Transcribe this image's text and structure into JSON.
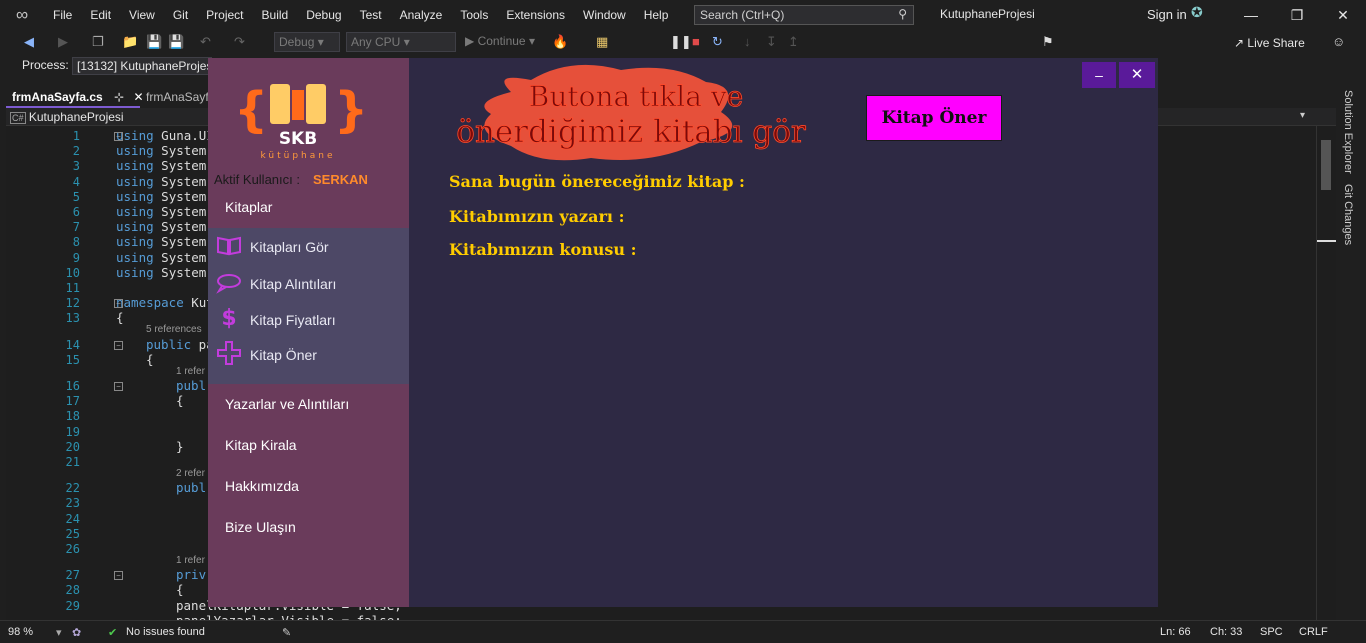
{
  "vs": {
    "menu": [
      "File",
      "Edit",
      "View",
      "Git",
      "Project",
      "Build",
      "Debug",
      "Test",
      "Analyze",
      "Tools",
      "Extensions",
      "Window",
      "Help"
    ],
    "search_placeholder": "Search (Ctrl+Q)",
    "project_title": "KutuphaneProjesi",
    "sign_in": "Sign in",
    "config_dropdown": "Debug",
    "platform_dropdown": "Any CPU",
    "continue_label": "Continue",
    "live_share": "Live Share",
    "process_label": "Process:",
    "process_value": "[13132] KutuphaneProjesi",
    "tabs": [
      "frmAnaSayfa.cs",
      "frmAnaSayfa"
    ],
    "nav_project": "KutuphaneProjesi",
    "right_tabs": [
      "Solution Explorer",
      "Git Changes"
    ],
    "status": {
      "zoom": "98 %",
      "issues": "No issues found",
      "ln": "Ln: 66",
      "ch": "Ch: 33",
      "spc": "SPC",
      "crlf": "CRLF"
    },
    "code_lines": [
      {
        "n": "1",
        "kw": "using",
        "rest": " Guna.UI"
      },
      {
        "n": "2",
        "kw": "using",
        "rest": " System"
      },
      {
        "n": "3",
        "kw": "using",
        "rest": " System"
      },
      {
        "n": "4",
        "kw": "using",
        "rest": " System"
      },
      {
        "n": "5",
        "kw": "using",
        "rest": " System"
      },
      {
        "n": "6",
        "kw": "using",
        "rest": " System"
      },
      {
        "n": "7",
        "kw": "using",
        "rest": " System"
      },
      {
        "n": "8",
        "kw": "using",
        "rest": " System"
      },
      {
        "n": "9",
        "kw": "using",
        "rest": " System"
      },
      {
        "n": "10",
        "kw": "using",
        "rest": " System"
      },
      {
        "n": "11",
        "kw": "",
        "rest": ""
      },
      {
        "n": "12",
        "kw": "namespace",
        "rest": " Kut"
      },
      {
        "n": "13",
        "kw": "",
        "rest": "{"
      },
      {
        "n": "14",
        "kw": "public",
        "rest": " pa"
      },
      {
        "n": "15",
        "kw": "",
        "rest": "{"
      },
      {
        "n": "16",
        "kw": "publ",
        "rest": ""
      },
      {
        "n": "17",
        "kw": "",
        "rest": "{"
      },
      {
        "n": "18",
        "kw": "",
        "rest": ""
      },
      {
        "n": "19",
        "kw": "",
        "rest": ""
      },
      {
        "n": "20",
        "kw": "",
        "rest": "}"
      },
      {
        "n": "21",
        "kw": "",
        "rest": ""
      },
      {
        "n": "22",
        "kw": "publ",
        "rest": ""
      },
      {
        "n": "23",
        "kw": "",
        "rest": ""
      },
      {
        "n": "24",
        "kw": "",
        "rest": ""
      },
      {
        "n": "25",
        "kw": "",
        "rest": ""
      },
      {
        "n": "26",
        "kw": "",
        "rest": ""
      },
      {
        "n": "27",
        "kw": "priv",
        "rest": ""
      },
      {
        "n": "28",
        "kw": "",
        "rest": "{"
      },
      {
        "n": "29",
        "kw": "",
        "rest": "panelKitaplar.Visible = false;"
      },
      {
        "n": "",
        "kw": "",
        "rest": "panelYazarlar.Visible = false;"
      }
    ],
    "refs": [
      "5 references",
      "1 refer",
      "2 refer",
      "1 refer"
    ]
  },
  "app": {
    "logo_text": "SKB",
    "logo_sub": "kütüphane",
    "active_user_label": "Aktif Kullanıcı :",
    "active_user_name": "SERKAN",
    "menu_kitaplar": "Kitaplar",
    "submenu": [
      {
        "label": "Kitapları Gör",
        "icon": "book-icon"
      },
      {
        "label": "Kitap Alıntıları",
        "icon": "chat-bubble-icon"
      },
      {
        "label": "Kitap Fiyatları",
        "icon": "dollar-icon"
      },
      {
        "label": "Kitap Öner",
        "icon": "plus-icon"
      }
    ],
    "menu_yazarlar": "Yazarlar ve Alıntıları",
    "menu_kirala": "Kitap Kirala",
    "menu_hakkimizda": "Hakkımızda",
    "menu_ulasin": "Bize Ulaşın",
    "banner_line1": "Butona tıkla ve",
    "banner_line2": "önerdiğimiz kitabı gör",
    "oner_button": "Kitap Öner",
    "label_onerilen": "Sana bugün önereceğimiz kitap :",
    "label_yazar": "Kitabımızın yazarı :",
    "label_konu": "Kitabımızın konusu :",
    "min_btn": "–",
    "close_btn": "✕",
    "colors": {
      "sidebar": "#6a3b5b",
      "submenu": "#4d4866",
      "content": "#2e2944",
      "accent_button": "#ff00ff",
      "label_yellow": "#ffcc00",
      "user_orange": "#ff8a2b"
    }
  }
}
